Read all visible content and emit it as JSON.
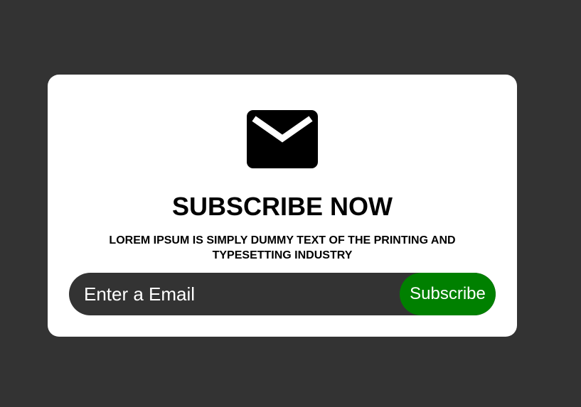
{
  "colors": {
    "page_background": "#333333",
    "card_background": "#ffffff",
    "input_background": "#333333",
    "button_background": "#008000",
    "text_dark": "#000000",
    "text_light": "#ffffff"
  },
  "card": {
    "icon": "envelope-icon",
    "title": "SUBSCRIBE NOW",
    "description": "LOREM IPSUM IS SIMPLY DUMMY TEXT OF THE PRINTING AND TYPESETTING INDUSTRY"
  },
  "form": {
    "email_placeholder": "Enter a Email",
    "email_value": "",
    "subscribe_label": "Subscribe"
  }
}
